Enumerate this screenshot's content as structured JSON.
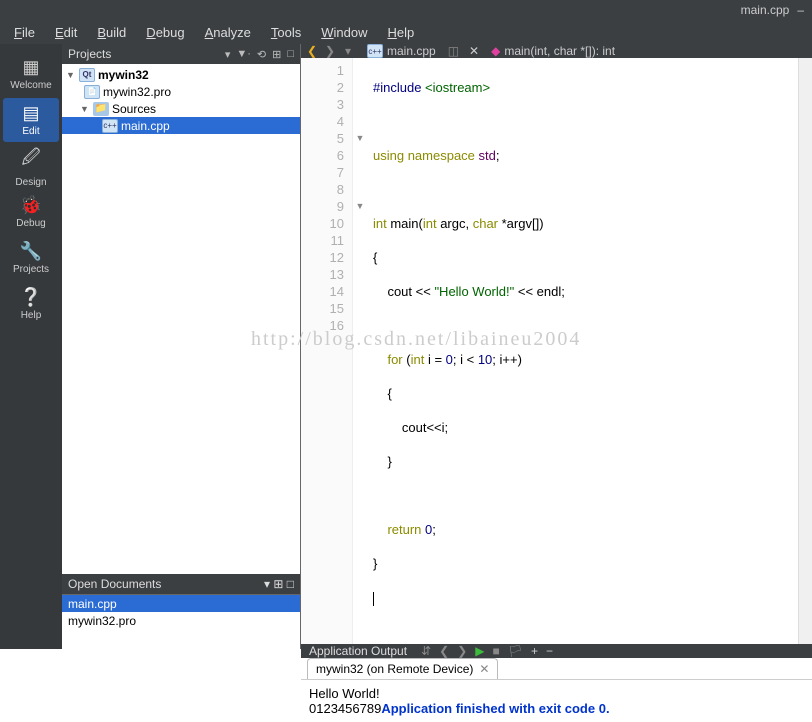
{
  "window": {
    "title": "main.cpp",
    "minimize": "–"
  },
  "menubar": {
    "file": "File",
    "edit": "Edit",
    "build": "Build",
    "debug": "Debug",
    "analyze": "Analyze",
    "tools": "Tools",
    "window": "Window",
    "help": "Help"
  },
  "sidebar": {
    "welcome": "Welcome",
    "edit": "Edit",
    "design": "Design",
    "debug": "Debug",
    "projects": "Projects",
    "help": "Help"
  },
  "projects": {
    "title": "Projects",
    "tree": {
      "root": "mywin32",
      "pro": "mywin32.pro",
      "sources": "Sources",
      "main": "main.cpp"
    }
  },
  "openDocs": {
    "title": "Open Documents",
    "items": [
      "main.cpp",
      "mywin32.pro"
    ]
  },
  "editor": {
    "tab": "main.cpp",
    "crumb": "main(int, char *[]): int",
    "lines": [
      1,
      2,
      3,
      4,
      5,
      6,
      7,
      8,
      9,
      10,
      11,
      12,
      13,
      14,
      15,
      16
    ],
    "code": {
      "l1_pp": "#include ",
      "l1_inc": "<iostream>",
      "l3_kw1": "using ",
      "l3_kw2": "namespace ",
      "l3_ns": "std",
      "l3_semi": ";",
      "l5_int": "int ",
      "l5_main": "main(",
      "l5_int2": "int ",
      "l5_argc": "argc, ",
      "l5_char": "char ",
      "l5_rest": "*argv[])",
      "l6": "{",
      "l7_a": "    cout << ",
      "l7_str": "\"Hello World!\"",
      "l7_b": " << endl;",
      "l9_a": "    ",
      "l9_for": "for ",
      "l9_b": "(",
      "l9_int": "int ",
      "l9_c": "i = ",
      "l9_n0": "0",
      "l9_d": "; i < ",
      "l9_n10": "10",
      "l9_e": "; i++)",
      "l10": "    {",
      "l11": "        cout<<i;",
      "l12": "    }",
      "l14_a": "    ",
      "l14_ret": "return ",
      "l14_n": "0",
      "l14_b": ";",
      "l15": "}"
    },
    "watermark": "http://blog.csdn.net/libaineu2004"
  },
  "output": {
    "title": "Application Output",
    "tab": "mywin32 (on Remote Device)",
    "line1": "Hello World!",
    "line2a": "0123456789",
    "line2b": "Application finished with exit code 0."
  }
}
